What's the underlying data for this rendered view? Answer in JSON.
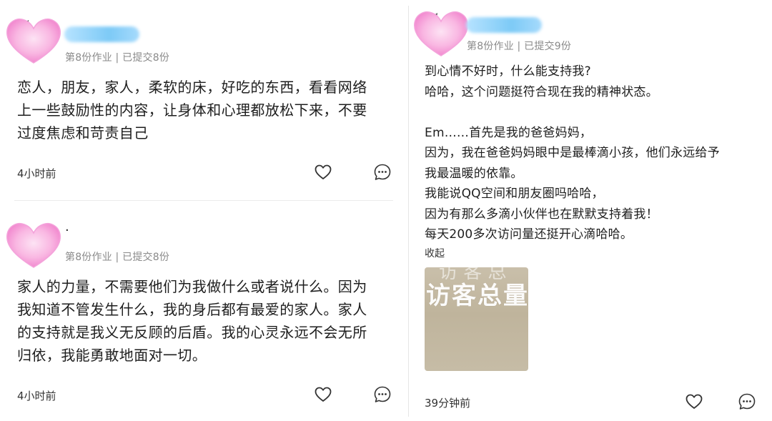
{
  "posts": [
    {
      "meta": "第8份作业 | 已提交8份",
      "lines": [
        "恋人，朋友，家人，柔软的床，好吃的东西，看看网络",
        "上一些鼓励性的内容，让身体和心理都放松下来，不要",
        "过度焦虑和苛责自己"
      ],
      "time": "4小时前"
    },
    {
      "username": "·",
      "meta": "第8份作业 | 已提交8份",
      "lines": [
        "家人的力量，不需要他们为我做什么或者说什么。因为",
        "我知道不管发生什么，我的身后都有最爱的家人。家人",
        "的支持就是我义无反顾的后盾。我的心灵永远不会无所",
        "归依，我能勇敢地面对一切。"
      ],
      "time": "4小时前"
    },
    {
      "meta": "第8份作业 | 已提交9份",
      "lines": [
        "到心情不好时，什么能支持我?",
        "哈哈，这个问题挺符合现在我的精神状态。",
        "",
        "Em……首先是我的爸爸妈妈，",
        "因为，我在爸爸妈妈眼中是最棒滴小孩，他们永远给予",
        "我最温暖的依靠。",
        "我能说QQ空间和朋友圈吗哈哈，",
        "因为有那么多滴小伙伴也在默默支持着我！",
        "每天200多次访问量还挺开心滴哈哈。"
      ],
      "collapse_label": "收起",
      "image_text": "访客总量",
      "time": "39分钟前"
    }
  ],
  "icons": {
    "like": "heart-outline-icon",
    "comment": "comment-bubble-icon"
  },
  "colors": {
    "avatar_pink": "#f7a8dc",
    "username_blur": "#7dcaf6",
    "meta_gray": "#8a8a8a"
  }
}
